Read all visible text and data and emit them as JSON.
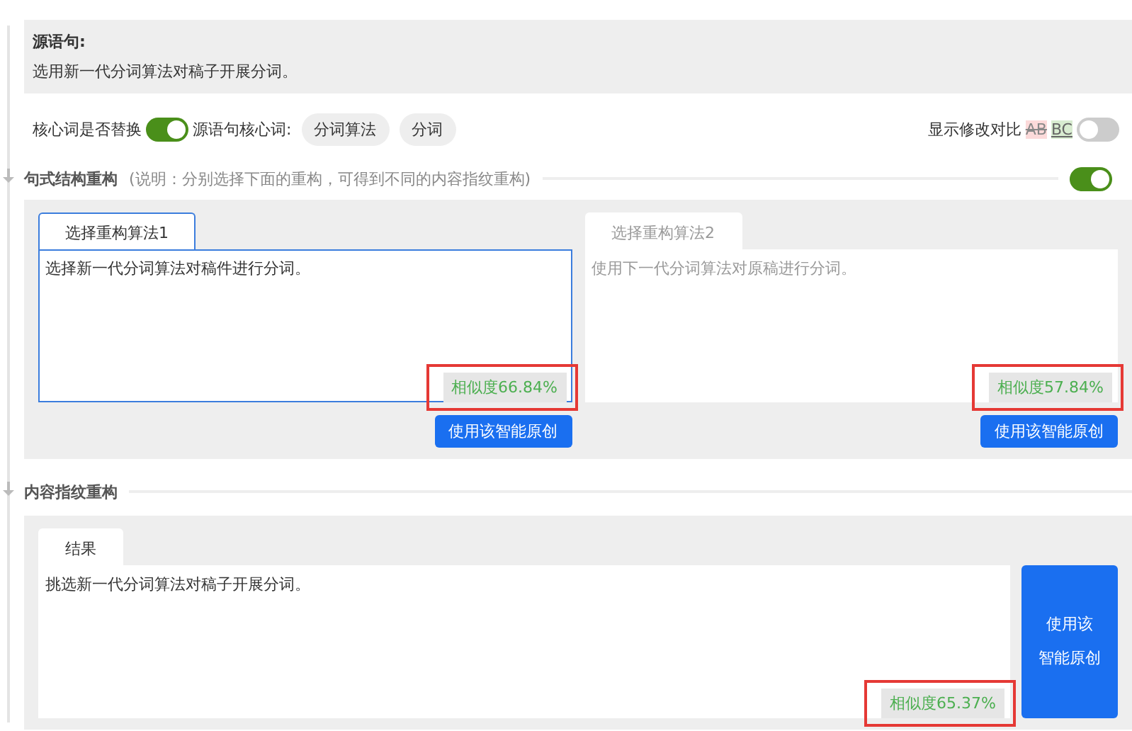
{
  "source": {
    "title": "源语句:",
    "text": "选用新一代分词算法对稿子开展分词。"
  },
  "options": {
    "replace_label": "核心词是否替换",
    "replace_on": true,
    "keywords_label": "源语句核心词:",
    "keywords": [
      "分词算法",
      "分词"
    ],
    "compare_label": "显示修改对比",
    "compare_removed": "AB",
    "compare_added": "BC",
    "compare_on": false
  },
  "structure": {
    "title": "句式结构重构",
    "note": "(说明：分别选择下面的重构，可得到不同的内容指纹重构)",
    "on": true,
    "options": [
      {
        "tab": "选择重构算法1",
        "selected": true,
        "text": "选择新一代分词算法对稿件进行分词。",
        "similarity": "相似度66.84%",
        "highlighted": true,
        "button": "使用该智能原创"
      },
      {
        "tab": "选择重构算法2",
        "selected": false,
        "text": "使用下一代分词算法对原稿进行分词。",
        "similarity": "相似度57.84%",
        "highlighted": true,
        "button": "使用该智能原创"
      }
    ]
  },
  "fingerprint": {
    "title": "内容指纹重构",
    "tab": "结果",
    "text": "挑选新一代分词算法对稿子开展分词。",
    "similarity": "相似度65.37%",
    "highlighted": true,
    "button_lines": [
      "使用该",
      "智能原创"
    ]
  }
}
